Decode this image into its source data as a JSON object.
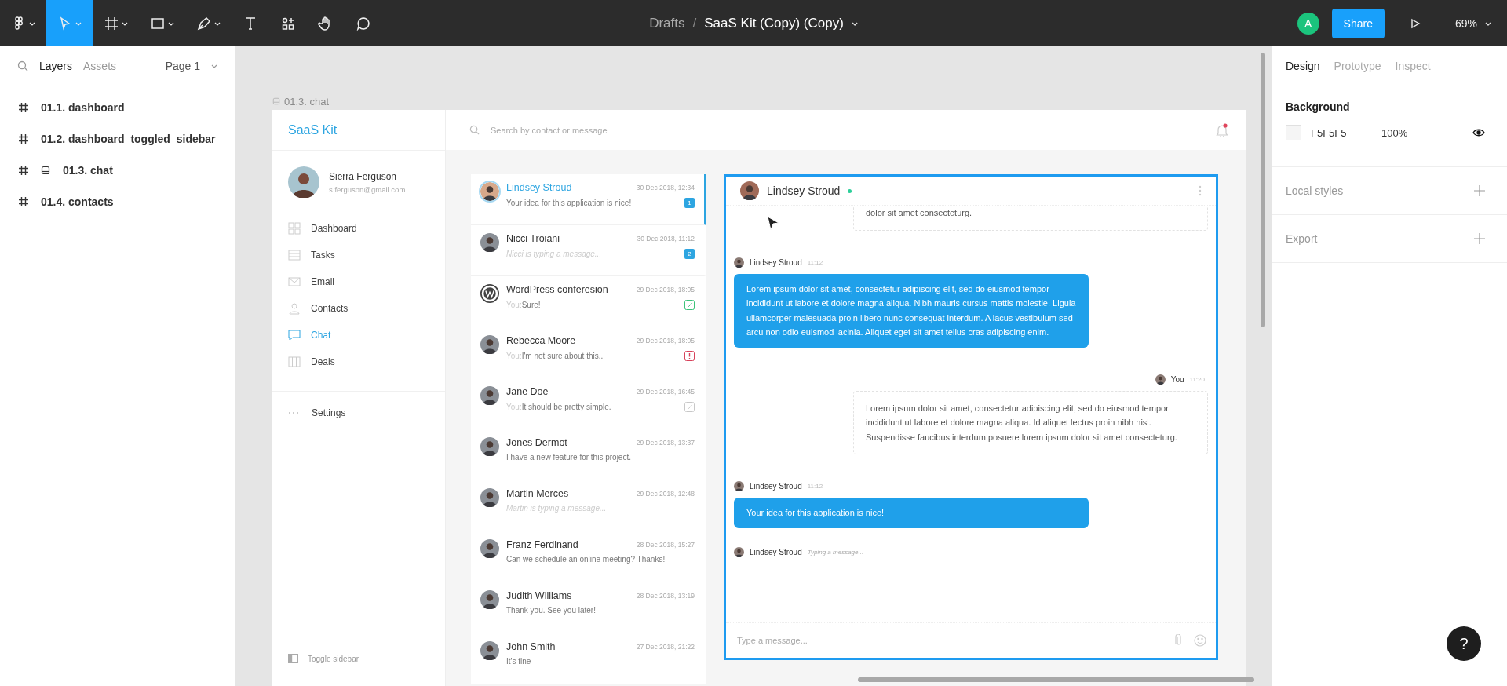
{
  "toolbar": {
    "tools": [
      {
        "kind": "logo",
        "selected": false
      },
      {
        "kind": "move",
        "selected": true
      },
      {
        "kind": "frame",
        "selected": false
      },
      {
        "kind": "rectangle",
        "selected": false
      },
      {
        "kind": "pen",
        "selected": false
      },
      {
        "kind": "text",
        "selected": false
      },
      {
        "kind": "components",
        "selected": false
      },
      {
        "kind": "hand",
        "selected": false
      },
      {
        "kind": "comment",
        "selected": false
      }
    ],
    "breadcrumb": "Drafts",
    "separator": "/",
    "file_title": "SaaS Kit (Copy) (Copy)",
    "avatar_initial": "A",
    "share": "Share",
    "zoom": "69%"
  },
  "left_panel": {
    "tabs": [
      {
        "label": "Layers",
        "selected": true
      },
      {
        "label": "Assets",
        "selected": false
      }
    ],
    "page": "Page 1",
    "layers": [
      {
        "name": "01.1. dashboard",
        "kind": "frame"
      },
      {
        "name": "01.2. dashboard_toggled_sidebar",
        "kind": "frame"
      },
      {
        "name": "01.3. chat",
        "kind": "prototype_frame"
      },
      {
        "name": "01.4. contacts",
        "kind": "frame"
      }
    ]
  },
  "canvas": {
    "frame_label": "01.3. chat"
  },
  "app": {
    "logo": "SaaS Kit",
    "user": {
      "name": "Sierra Ferguson",
      "email": "s.ferguson@gmail.com"
    },
    "nav": [
      {
        "label": "Dashboard",
        "kind": "dashboard",
        "selected": false
      },
      {
        "label": "Tasks",
        "kind": "tasks",
        "selected": false
      },
      {
        "label": "Email",
        "kind": "email",
        "selected": false
      },
      {
        "label": "Contacts",
        "kind": "contacts",
        "selected": false
      },
      {
        "label": "Chat",
        "kind": "chat",
        "selected": true
      },
      {
        "label": "Deals",
        "kind": "deals",
        "selected": false
      }
    ],
    "settings": "Settings",
    "toggle_sidebar": "Toggle sidebar",
    "search_placeholder": "Search by contact or message",
    "unread_notifications": true
  },
  "conversations": [
    {
      "name": "Lindsey Stroud",
      "time": "30 Dec 2018, 12:34",
      "preview": "Your idea for this application is nice!",
      "logo_avatar": false,
      "kind": "unread",
      "badge": "1",
      "typing": false,
      "selected": true
    },
    {
      "name": "Nicci Troiani",
      "time": "30 Dec 2018, 11:12",
      "preview": "Nicci is typing a message...",
      "logo_avatar": false,
      "kind": "unread",
      "badge": "2",
      "typing": true,
      "selected": false
    },
    {
      "name": "WordPress conferesion",
      "time": "29 Dec 2018, 18:05",
      "prefix": "You:",
      "preview": "Sure!",
      "logo_avatar": true,
      "kind": "read",
      "typing": false,
      "selected": false
    },
    {
      "name": "Rebecca Moore",
      "time": "29 Dec 2018, 18:05",
      "prefix": "You:",
      "preview": "I'm not sure about this..",
      "logo_avatar": false,
      "kind": "failed",
      "typing": false,
      "selected": false
    },
    {
      "name": "Jane Doe",
      "time": "29 Dec 2018, 16:45",
      "prefix": "You:",
      "preview": "It should be pretty simple.",
      "logo_avatar": false,
      "kind": "seen",
      "typing": false,
      "selected": false
    },
    {
      "name": "Jones Dermot",
      "time": "29 Dec 2018, 13:37",
      "preview": "I have a new feature for this project.",
      "logo_avatar": false,
      "kind": "plain",
      "typing": false,
      "selected": false
    },
    {
      "name": "Martin Merces",
      "time": "29 Dec 2018, 12:48",
      "preview": "Martin is typing a message...",
      "logo_avatar": false,
      "kind": "plain",
      "typing": true,
      "selected": false
    },
    {
      "name": "Franz Ferdinand",
      "time": "28 Dec 2018, 15:27",
      "preview": "Can we schedule an online meeting? Thanks!",
      "logo_avatar": false,
      "kind": "plain",
      "typing": false,
      "selected": false
    },
    {
      "name": "Judith Williams",
      "time": "28 Dec 2018, 13:19",
      "preview": "Thank you. See you later!",
      "logo_avatar": false,
      "kind": "plain",
      "typing": false,
      "selected": false
    },
    {
      "name": "John Smith",
      "time": "27 Dec 2018, 21:22",
      "preview": "It's fine",
      "logo_avatar": false,
      "kind": "plain",
      "typing": false,
      "selected": false
    }
  ],
  "chat": {
    "contact": "Lindsey Stroud",
    "online": true,
    "messages": [
      {
        "kind": "outgoing",
        "text": "dolor sit amet consecteturg."
      },
      {
        "kind": "incoming",
        "author": "Lindsey Stroud",
        "time": "11:12",
        "text": "Lorem ipsum dolor sit amet, consectetur adipiscing elit, sed do eiusmod tempor incididunt ut labore et dolore magna aliqua. Nibh mauris cursus mattis molestie. Ligula ullamcorper malesuada proin libero nunc consequat interdum. A lacus vestibulum sed arcu non odio euismod lacinia. Aliquet eget sit amet tellus cras adipiscing enim."
      },
      {
        "kind": "outgoing",
        "author": "You",
        "time": "11:20",
        "text": "Lorem ipsum dolor sit amet, consectetur adipiscing elit, sed do eiusmod tempor incididunt ut labore et dolore magna aliqua. Id aliquet lectus proin nibh nisl. Suspendisse faucibus interdum posuere lorem ipsum dolor sit amet consecteturg."
      },
      {
        "kind": "incoming",
        "author": "Lindsey Stroud",
        "time": "11:12",
        "text": "Your idea for this application is nice!"
      }
    ],
    "typing": {
      "author": "Lindsey Stroud",
      "text": "Typing a message..."
    },
    "input_placeholder": "Type a message..."
  },
  "right_panel": {
    "tabs": [
      {
        "label": "Design",
        "selected": true
      },
      {
        "label": "Prototype",
        "selected": false
      },
      {
        "label": "Inspect",
        "selected": false
      }
    ],
    "background": {
      "title": "Background",
      "hex": "F5F5F5",
      "color": "#f5f5f5",
      "opacity": "100%"
    },
    "sections": [
      "Local styles",
      "Export"
    ]
  },
  "help": "?"
}
